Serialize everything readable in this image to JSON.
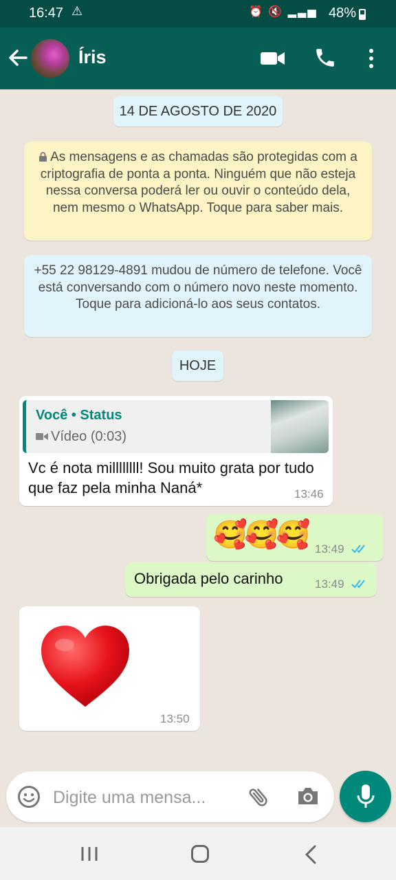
{
  "status_bar": {
    "time": "16:47",
    "battery": "48%"
  },
  "header": {
    "contact_name": "Íris"
  },
  "chat": {
    "date_separator": "14 DE AGOSTO DE 2020",
    "encryption_notice": "As mensagens e as chamadas são protegidas com a criptografia de ponta a ponta. Ninguém que não esteja nessa conversa poderá ler ou ouvir o conteúdo dela, nem mesmo o WhatsApp. Toque para saber mais.",
    "number_change_notice": "+55 22 98129-4891 mudou de número de telefone. Você está conversando com o número novo neste momento. Toque para adicioná-lo aos seus contatos.",
    "today_separator": "HOJE",
    "messages": [
      {
        "direction": "incoming",
        "quote_author": "Você • Status",
        "quote_type": "Vídeo (0:03)",
        "text": "Vc é nota millllllll! Sou muito grata por tudo que faz pela minha Naná*",
        "time": "13:46"
      },
      {
        "direction": "outgoing",
        "text": "🥰🥰🥰",
        "time": "13:49",
        "status": "read"
      },
      {
        "direction": "outgoing",
        "text": "Obrigada pelo carinho",
        "time": "13:49",
        "status": "read"
      },
      {
        "direction": "incoming",
        "sticker": "heart",
        "time": "13:50"
      }
    ]
  },
  "composer": {
    "placeholder": "Digite uma mensa..."
  },
  "colors": {
    "header": "#075e54",
    "status_bar": "#054d44",
    "accent": "#00897b",
    "outgoing_bubble": "#dcf8c6",
    "incoming_bubble": "#ffffff",
    "read_tick": "#34b7f1"
  }
}
